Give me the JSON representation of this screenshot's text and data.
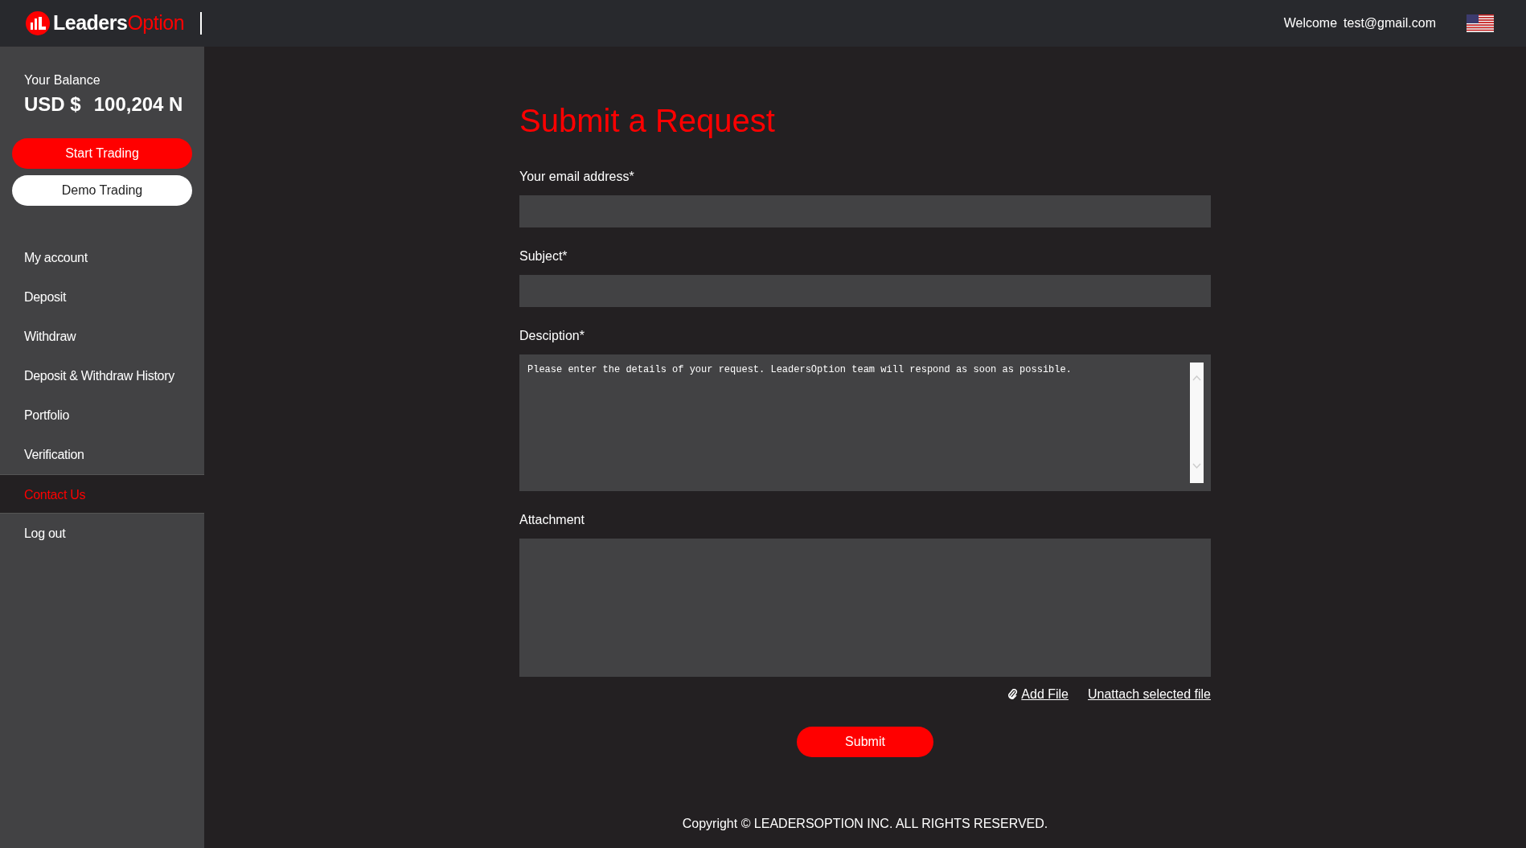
{
  "header": {
    "logo_first": "Leaders",
    "logo_second": "Option",
    "welcome": "Welcome",
    "email": "test@gmail.com"
  },
  "sidebar": {
    "balance_label": "Your Balance",
    "currency": "USD $",
    "amount": "100,204 N",
    "buttons": [
      {
        "label": "Start Trading",
        "kind": "primary"
      },
      {
        "label": "Demo Trading",
        "kind": "light"
      }
    ],
    "items": [
      {
        "label": "My account",
        "selected": false
      },
      {
        "label": "Deposit",
        "selected": false
      },
      {
        "label": "Withdraw",
        "selected": false
      },
      {
        "label": "Deposit & Withdraw History",
        "selected": false
      },
      {
        "label": "Portfolio",
        "selected": false
      },
      {
        "label": "Verification",
        "selected": false
      },
      {
        "label": "Contact Us",
        "selected": true
      },
      {
        "label": "Log out",
        "selected": false
      }
    ]
  },
  "form": {
    "title": "Submit a Request",
    "fields": [
      {
        "label": "Your email address*",
        "kind": "input"
      },
      {
        "label": "Subject*",
        "kind": "input"
      },
      {
        "label": "Desciption*",
        "kind": "textarea",
        "placeholder": "Please enter the details of your request. LeadersOption team will respond as soon as possible."
      },
      {
        "label": "Attachment",
        "kind": "dropzone"
      }
    ],
    "add_file": "Add File",
    "unattach": "Unattach selected file",
    "submit": "Submit"
  },
  "footer": "Copyright © LEADERSOPTION INC. ALL RIGHTS RESERVED."
}
